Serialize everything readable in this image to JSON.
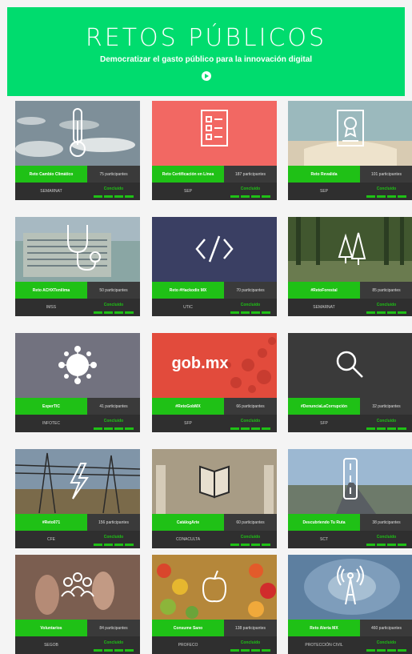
{
  "header": {
    "title": "RETOS PÚBLICOS",
    "subtitle": "Democratizar el gasto público para la innovación digital",
    "bg_color": "#00dc6e"
  },
  "status_color": "#1fc116",
  "cards": [
    {
      "name": "Reto Cambio Climático",
      "participants": "75 participantes",
      "org": "SEMARNAT",
      "status": "Concluido",
      "icon": "thermometer-icon",
      "theme": "ice"
    },
    {
      "name": "Reto Certificación en Línea",
      "participants": "187 participantes",
      "org": "SEP",
      "status": "Concluido",
      "icon": "document-checklist-icon",
      "theme": "coral"
    },
    {
      "name": "Reto Revalida",
      "participants": "101 participantes",
      "org": "SEP",
      "status": "Concluido",
      "icon": "certificate-icon",
      "theme": "book"
    },
    {
      "name": "Reto ACHXTenilima",
      "participants": "50 participantes",
      "org": "IMSS",
      "status": "Concluido",
      "icon": "stethoscope-icon",
      "theme": "building"
    },
    {
      "name": "Reto #Hackodix MX",
      "participants": "70 participantes",
      "org": "UTIC",
      "status": "Concluido",
      "icon": "code-icon",
      "theme": "navy"
    },
    {
      "name": "#RetoForestal",
      "participants": "85 participantes",
      "org": "SEMARNAT",
      "status": "Concluido",
      "icon": "trees-icon",
      "theme": "forest"
    },
    {
      "name": "ExperTIC",
      "participants": "41 participantes",
      "org": "INFOTEC",
      "status": "Concluido",
      "icon": "network-icon",
      "theme": "slate"
    },
    {
      "name": "#RetoGobMX",
      "participants": "66 participantes",
      "org": "SFP",
      "status": "Concluido",
      "icon": "gobmx-logo",
      "theme": "red",
      "logo_text": "gob.mx"
    },
    {
      "name": "#DenunciaLaCorrupción",
      "participants": "32 participantes",
      "org": "SFP",
      "status": "Concluido",
      "icon": "magnifier-icon",
      "theme": "dark"
    },
    {
      "name": "#Reto071",
      "participants": "156 participantes",
      "org": "CFE",
      "status": "Concluido",
      "icon": "lightning-icon",
      "theme": "tower"
    },
    {
      "name": "CatálogArte",
      "participants": "60 participantes",
      "org": "CONACULTA",
      "status": "Concluido",
      "icon": "open-book-icon",
      "theme": "palace"
    },
    {
      "name": "Descubriendo Tu Ruta",
      "participants": "38 participantes",
      "org": "SCT",
      "status": "Concluido",
      "icon": "road-icon",
      "theme": "road"
    },
    {
      "name": "Voluntarios",
      "participants": "84 participantes",
      "org": "SEGOB",
      "status": "Concluido",
      "icon": "people-group-icon",
      "theme": "hands"
    },
    {
      "name": "Consume Sano",
      "participants": "138 participantes",
      "org": "PROFECO",
      "status": "Concluido",
      "icon": "apple-icon",
      "theme": "market"
    },
    {
      "name": "Reto Alerta MX",
      "participants": "460 participantes",
      "org": "PROTECCIÓN CIVIL",
      "status": "Concluido",
      "icon": "antenna-icon",
      "theme": "storm"
    }
  ]
}
